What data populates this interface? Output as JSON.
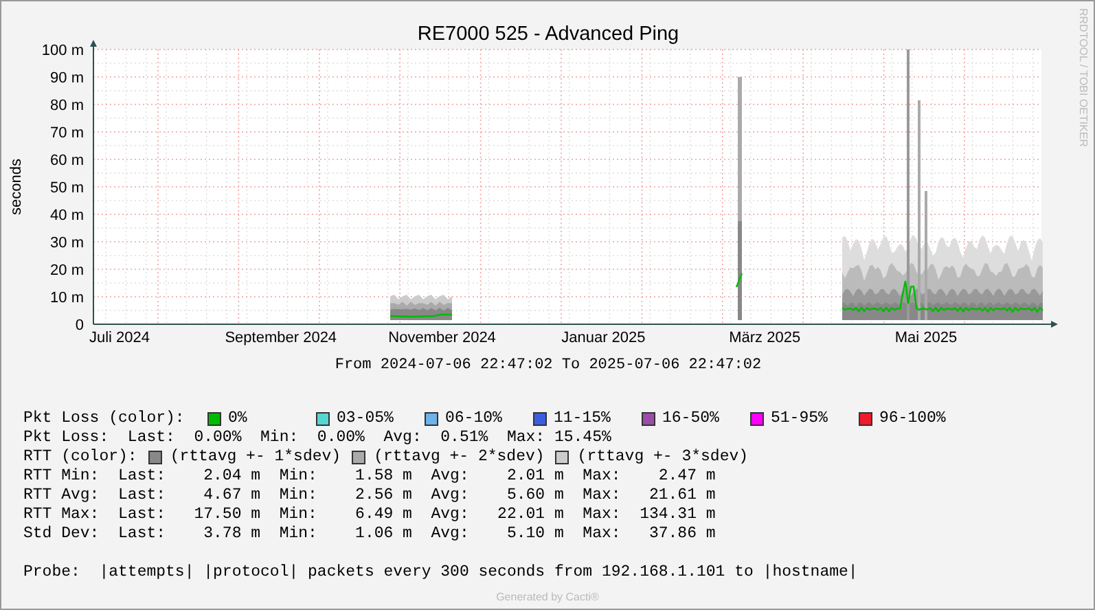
{
  "title": "RE7000 525 - Advanced Ping",
  "side_credit": "RRDTOOL / TOBI OETIKER",
  "y_axis_label": "seconds",
  "y_tick_labels": [
    "100 m",
    "90 m",
    "80 m",
    "70 m",
    "60 m",
    "50 m",
    "40 m",
    "30 m",
    "20 m",
    "10 m",
    "0"
  ],
  "x_tick_labels": [
    "Juli 2024",
    "September 2024",
    "November 2024",
    "Januar 2025",
    "März 2025",
    "Mai 2025"
  ],
  "time_range": "From 2024-07-06 22:47:02 To 2025-07-06 22:47:02",
  "pkt_loss_colors": {
    "label": "Pkt Loss (color):",
    "items": [
      {
        "label": "0%",
        "color": "#00bb00"
      },
      {
        "label": "03-05%",
        "color": "#55d6d3"
      },
      {
        "label": "06-10%",
        "color": "#6db3ec"
      },
      {
        "label": "11-15%",
        "color": "#3b5ee0"
      },
      {
        "label": "16-50%",
        "color": "#9b4ea8"
      },
      {
        "label": "51-95%",
        "color": "#ff00ff"
      },
      {
        "label": "96-100%",
        "color": "#f01a2a"
      }
    ]
  },
  "pkt_loss_stats": "Pkt Loss:  Last:  0.00%  Min:  0.00%  Avg:  0.51%  Max: 15.45%",
  "rtt_colors": {
    "label": "RTT (color):",
    "items": [
      {
        "label": "(rttavg +- 1*sdev)",
        "color": "#888888"
      },
      {
        "label": "(rttavg +- 2*sdev)",
        "color": "#aaaaaa"
      },
      {
        "label": "(rttavg +- 3*sdev)",
        "color": "#cccccc"
      }
    ]
  },
  "stats_rows": [
    "RTT Min:  Last:    2.04 m  Min:    1.58 m  Avg:    2.01 m  Max:    2.47 m",
    "RTT Avg:  Last:    4.67 m  Min:    2.56 m  Avg:    5.60 m  Max:   21.61 m",
    "RTT Max:  Last:   17.50 m  Min:    6.49 m  Avg:   22.01 m  Max:  134.31 m",
    "Std Dev:  Last:    3.78 m  Min:    1.06 m  Avg:    5.10 m  Max:   37.86 m"
  ],
  "probe": "Probe:  |attempts| |protocol| packets every 300 seconds from 192.168.1.101 to |hostname|",
  "footer": "Generated by Cacti®"
}
